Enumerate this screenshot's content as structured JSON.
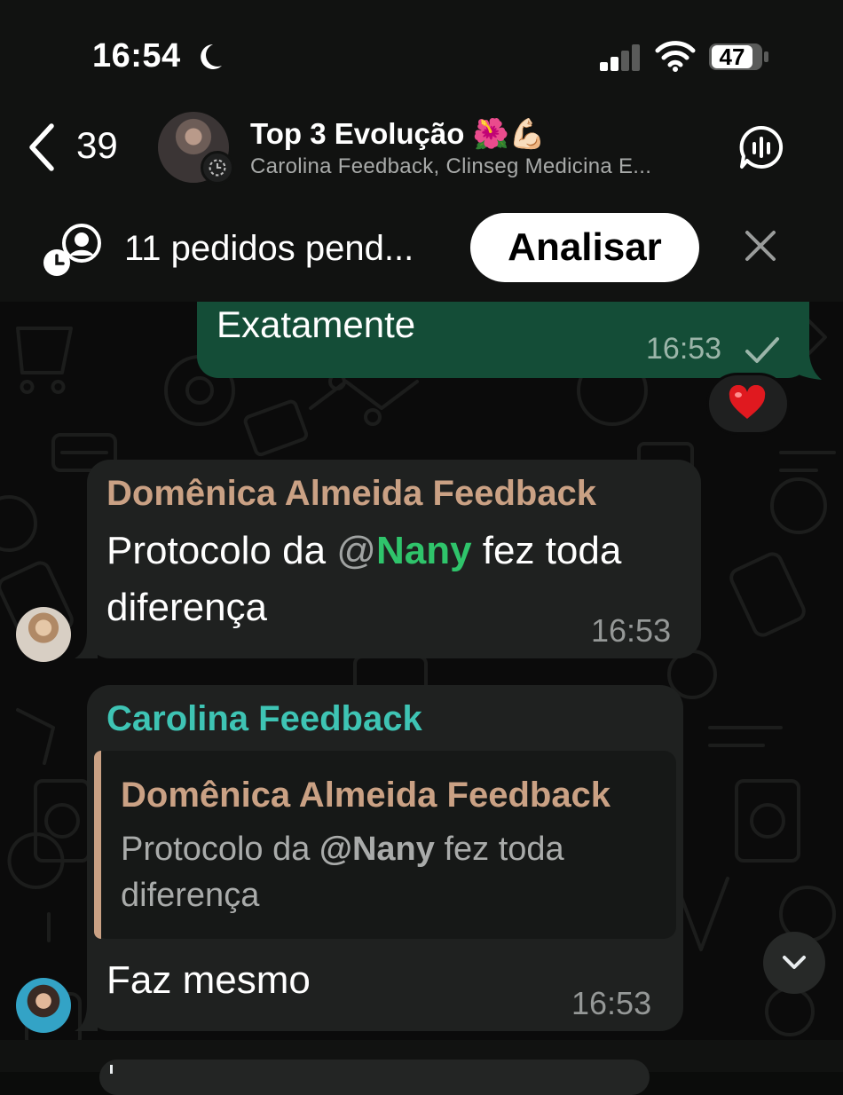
{
  "status_bar": {
    "time": "16:54",
    "battery": "47",
    "icons": [
      "moon-icon",
      "signal-icon",
      "wifi-icon",
      "battery-icon"
    ]
  },
  "header": {
    "back_count": "39",
    "title": "Top 3 Evolução 🌺💪🏻",
    "subtitle": "Carolina Feedback, Clinseg Medicina E..."
  },
  "pending_banner": {
    "text": "11 pedidos pend...",
    "button_label": "Analisar"
  },
  "messages": [
    {
      "direction": "outgoing",
      "text": "Exatamente",
      "time": "16:53",
      "reaction": "❤️"
    },
    {
      "direction": "incoming",
      "sender": "Domênica Almeida Feedback",
      "text_before": "Protocolo da ",
      "mention_at": "@",
      "mention_name": "Nany",
      "text_after": " fez toda",
      "text_line2": "diferença",
      "time": "16:53"
    },
    {
      "direction": "incoming",
      "sender": "Carolina Feedback",
      "quote": {
        "sender": "Domênica Almeida Feedback",
        "text_before": "Protocolo da ",
        "mention": "@Nany",
        "text_after": " fez toda",
        "text_line2": "diferença"
      },
      "text": "Faz mesmo",
      "time": "16:53"
    }
  ],
  "colors": {
    "outgoing_bubble": "#144d37",
    "incoming_bubble": "#1f2120",
    "sender_domenica": "#caa184",
    "sender_carolina": "#3ec4b4",
    "mention": "#2fc46b"
  }
}
